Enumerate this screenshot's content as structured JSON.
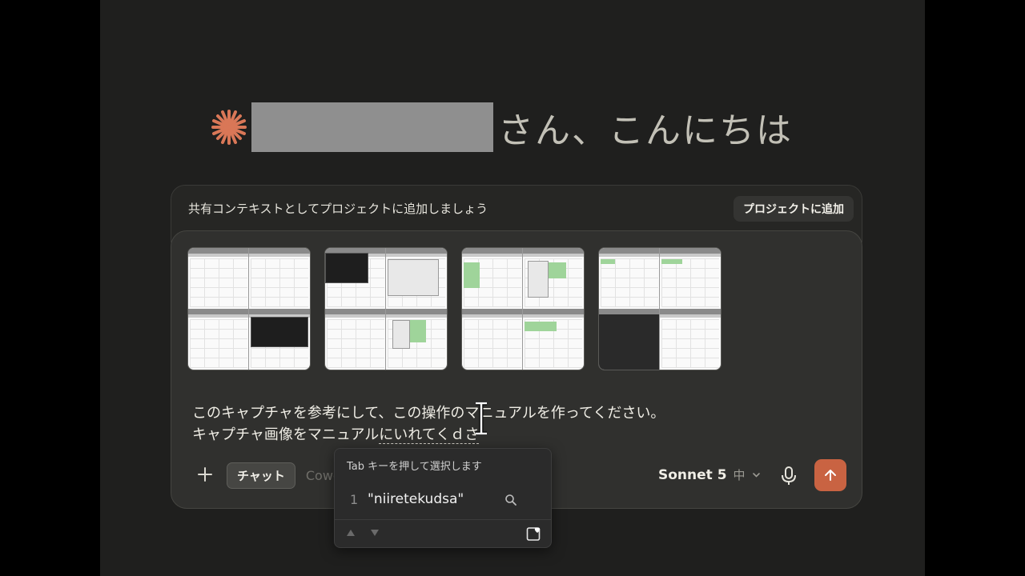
{
  "greeting": {
    "suffix": "さん、こんにちは"
  },
  "project": {
    "prompt_text": "共有コンテキストとしてプロジェクトに追加しましょう",
    "add_button": "プロジェクトに追加"
  },
  "attachments": {
    "thumbnails": [
      "screenshot-thumbnail-1",
      "screenshot-thumbnail-2",
      "screenshot-thumbnail-3",
      "screenshot-thumbnail-4"
    ]
  },
  "message": {
    "line1": "このキャプチャを参考にして、この操作のマニュアルを作ってください。",
    "line2_committed": "キャプチャ画像をマニュアル",
    "line2_composing": "にいれてくｄさ"
  },
  "toolbar": {
    "mode_chat": "チャット",
    "mode_cowork": "Cowo",
    "model_name": "Sonnet 5",
    "model_effort": "中"
  },
  "ime": {
    "hint": "Tab キーを押して選択します",
    "candidates": [
      {
        "number": "1",
        "text": "\"niiretekudsa\""
      }
    ]
  },
  "colors": {
    "accent": "#c96342",
    "background": "#1f1f1e",
    "composer": "#30302e"
  },
  "icons": {
    "brand": "asterisk-icon",
    "add": "plus-icon",
    "dropdown": "chevron-down-icon",
    "mic": "microphone-icon",
    "send": "arrow-up-icon",
    "search": "search-icon",
    "cursor": "ibeam-cursor-icon"
  }
}
